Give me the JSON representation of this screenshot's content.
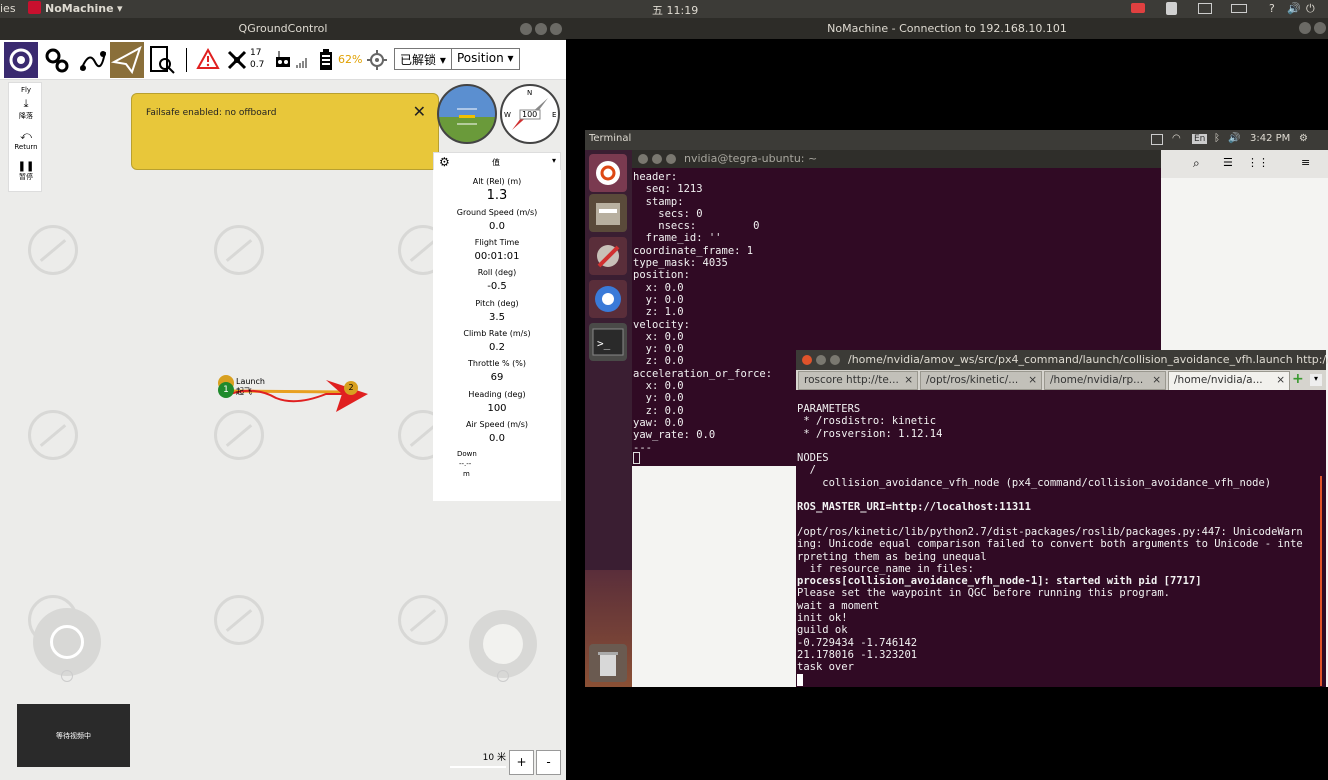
{
  "top_panel": {
    "left_fragment": "ies",
    "app": "NoMachine",
    "clock": "五 11:19"
  },
  "qgc": {
    "title": "QGroundControl",
    "sat_count": "17",
    "sat_hdop": "0.7",
    "battery": "62%",
    "arm_state": "已解锁",
    "flight_mode": "Position",
    "fly_tools": [
      {
        "label": "Fly"
      },
      {
        "label": "降落"
      },
      {
        "label": "Return"
      },
      {
        "label": "暂停"
      }
    ],
    "failsafe_msg": "Failsafe enabled: no offboard",
    "compass_heading": "100",
    "values_header": "值",
    "values": [
      {
        "label": "Alt (Rel) (m)",
        "value": "1.3"
      },
      {
        "label": "Ground Speed (m/s)",
        "value": "0.0"
      },
      {
        "label": "Flight Time",
        "value": "00:01:01"
      },
      {
        "label": "Roll (deg)",
        "value": "-0.5"
      },
      {
        "label": "Pitch (deg)",
        "value": "3.5"
      },
      {
        "label": "Climb Rate (m/s)",
        "value": "0.2"
      },
      {
        "label": "Throttle % (%)",
        "value": "69"
      },
      {
        "label": "Heading (deg)",
        "value": "100"
      },
      {
        "label": "Air Speed (m/s)",
        "value": "0.0"
      }
    ],
    "down_label": "Down",
    "down_value": "--.--",
    "down_unit": "m",
    "launch_label": "Launch",
    "takeoff_label": "起飞",
    "waypoint_1": "1",
    "waypoint_2": "2",
    "video_status": "等待视频中",
    "scale": "10 米",
    "zoom_in": "+",
    "zoom_out": "-"
  },
  "nomachine": {
    "title": "NoMachine - Connection to 192.168.10.101"
  },
  "remote": {
    "panel_app": "Terminal",
    "lang": "En",
    "time": "3:42 PM",
    "term1_title": "nvidia@tegra-ubuntu: ~",
    "term1_lines": "header:\n  seq: 1213\n  stamp:\n    secs: 0\n    nsecs:         0\n  frame_id: ''\ncoordinate_frame: 1\ntype_mask: 4035\nposition:\n  x: 0.0\n  y: 0.0\n  z: 1.0\nvelocity:\n  x: 0.0\n  y: 0.0\n  z: 0.0\nacceleration_or_force:\n  x: 0.0\n  y: 0.0\n  z: 0.0\nyaw: 0.0\nyaw_rate: 0.0\n---",
    "term2_title": "/home/nvidia/amov_ws/src/px4_command/launch/collision_avoidance_vfh.launch http://l",
    "tabs": [
      {
        "label": "roscore http://te..."
      },
      {
        "label": "/opt/ros/kinetic/..."
      },
      {
        "label": "/home/nvidia/rp..."
      },
      {
        "label": "/home/nvidia/a..."
      }
    ],
    "term2_lines": [
      {
        "text": "PARAMETERS",
        "bold": false
      },
      {
        "text": " * /rosdistro: kinetic",
        "bold": false
      },
      {
        "text": " * /rosversion: 1.12.14",
        "bold": false
      },
      {
        "text": "",
        "bold": false
      },
      {
        "text": "NODES",
        "bold": false
      },
      {
        "text": "  /",
        "bold": false
      },
      {
        "text": "    collision_avoidance_vfh_node (px4_command/collision_avoidance_vfh_node)",
        "bold": false
      },
      {
        "text": "",
        "bold": false
      },
      {
        "text": "ROS_MASTER_URI=http://localhost:11311",
        "bold": true
      },
      {
        "text": "",
        "bold": false
      },
      {
        "text": "/opt/ros/kinetic/lib/python2.7/dist-packages/roslib/packages.py:447: UnicodeWarn",
        "bold": false
      },
      {
        "text": "ing: Unicode equal comparison failed to convert both arguments to Unicode - inte",
        "bold": false
      },
      {
        "text": "rpreting them as being unequal",
        "bold": false
      },
      {
        "text": "  if resource_name in files:",
        "bold": false
      },
      {
        "text": "process[collision_avoidance_vfh_node-1]: started with pid [7717]",
        "bold": true
      },
      {
        "text": "Please set the waypoint in QGC before running this program.",
        "bold": false
      },
      {
        "text": "wait a moment",
        "bold": false
      },
      {
        "text": "init ok!",
        "bold": false
      },
      {
        "text": "guild ok",
        "bold": false
      },
      {
        "text": "-0.729434 -1.746142",
        "bold": false
      },
      {
        "text": "21.178016 -1.323201",
        "bold": false
      },
      {
        "text": "task over",
        "bold": false
      }
    ]
  }
}
